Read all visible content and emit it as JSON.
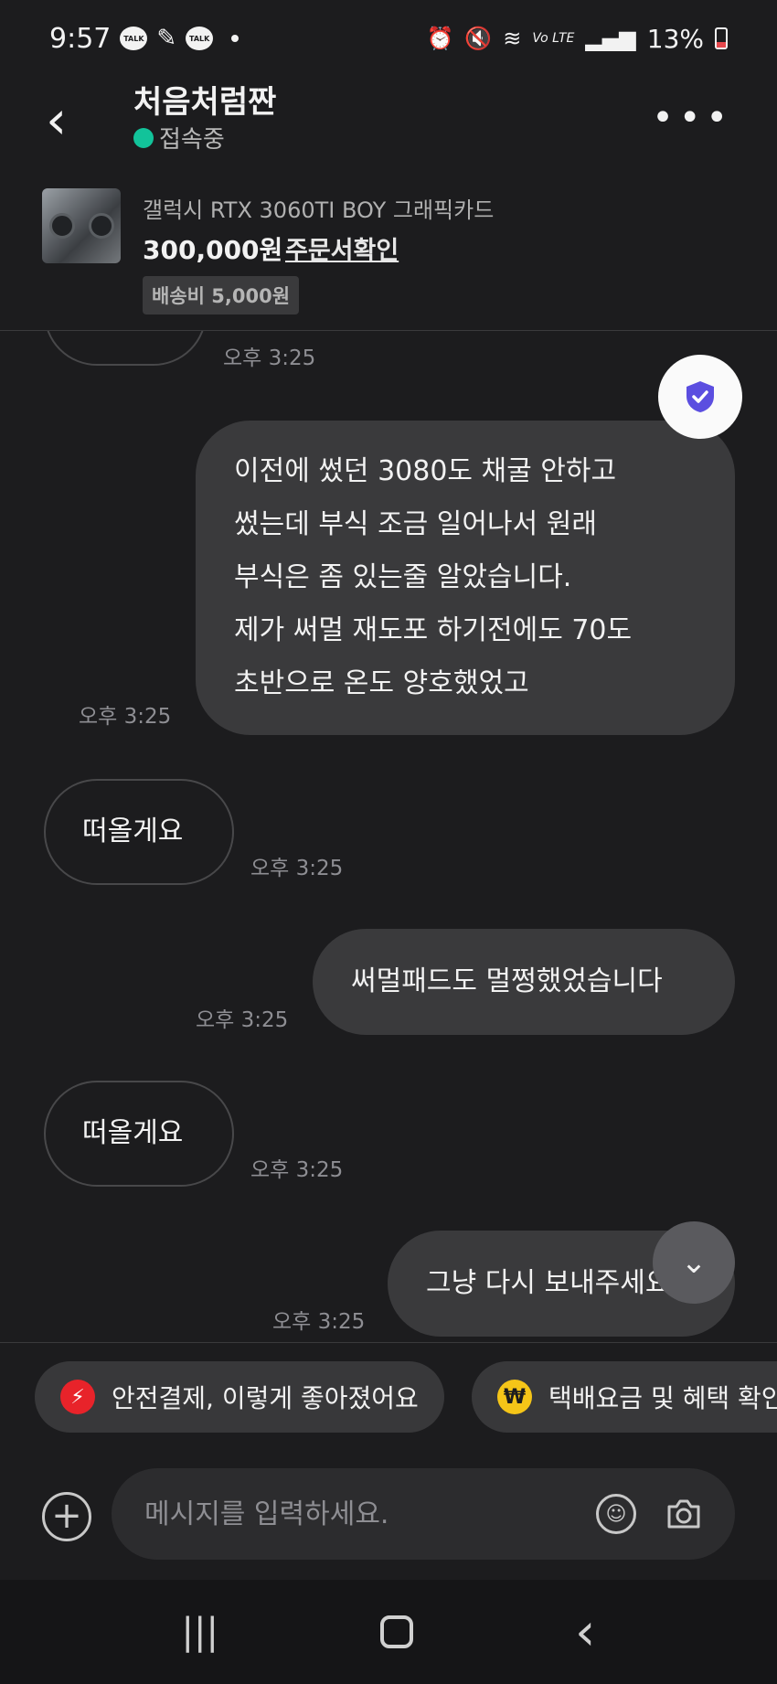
{
  "status_bar": {
    "time": "9:57",
    "talk_badge": "TALK",
    "lte": "Vo LTE",
    "battery": "13%",
    "icons": [
      "talk-icon",
      "feather-icon",
      "talk-icon",
      "alarm-icon",
      "mute-icon",
      "wifi-icon",
      "signal-icon",
      "battery-icon"
    ]
  },
  "header": {
    "back_icon": "‹",
    "name": "처음처럼짠",
    "status": "접속중",
    "more_icon": "•••"
  },
  "product": {
    "title": "갤럭시 RTX 3060TI BOY 그래픽카드",
    "price": "300,000원",
    "order_link": "주문서확인",
    "shipping": "배송비 5,000원"
  },
  "messages": [
    {
      "side": "in",
      "text": "",
      "time": "오후 3:25"
    },
    {
      "side": "out",
      "lines": [
        "이전에 썼던 3080도 채굴 안하고",
        "썼는데 부식 조금 일어나서 원래",
        "부식은 좀 있는줄 알았습니다.",
        "제가 써멀 재도포 하기전에도 70도",
        "초반으로 온도 양호했었고"
      ],
      "time": "오후 3:25"
    },
    {
      "side": "in",
      "text": "떠올게요",
      "time": "오후 3:25"
    },
    {
      "side": "out",
      "text": "써멀패드도 멀쩡했었습니다",
      "time": "오후 3:25"
    },
    {
      "side": "in",
      "text": "떠올게요",
      "time": "오후 3:25"
    },
    {
      "side": "out",
      "text": "그냥 다시 보내주세요",
      "time": "오후 3:25"
    }
  ],
  "quick_actions": [
    {
      "label": "안전결제, 이렇게 좋아졌어요",
      "icon": "lightning-icon",
      "color": "#e8232a"
    },
    {
      "label": "택배요금 및 혜택 확인",
      "icon": "won-icon",
      "color": "#f5c518"
    }
  ],
  "composer": {
    "placeholder": "메시지를 입력하세요."
  },
  "nav": {
    "recents": "|||",
    "back": "‹"
  }
}
